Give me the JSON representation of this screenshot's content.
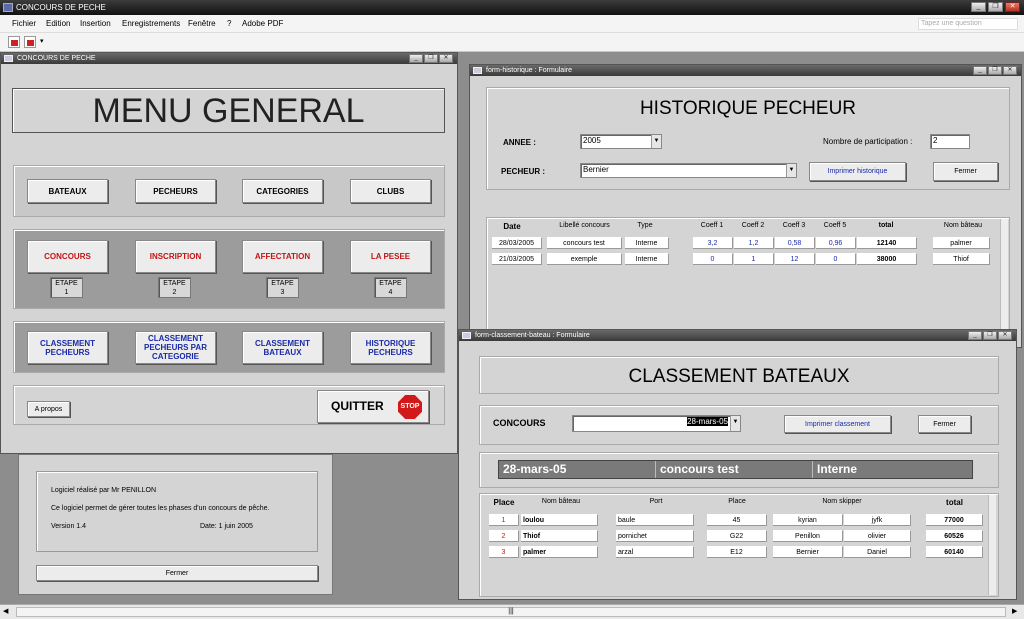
{
  "app": {
    "title": "CONCOURS DE PECHE"
  },
  "menu": {
    "items": [
      "Fichier",
      "Edition",
      "Insertion",
      "Enregistrements",
      "Fenêtre",
      "?",
      "Adobe PDF"
    ],
    "ask_placeholder": "Tapez une question"
  },
  "menu_general": {
    "window_title": "CONCOURS DE PECHE",
    "heading": "MENU GENERAL",
    "row1": [
      "BATEAUX",
      "PECHEURS",
      "CATEGORIES",
      "CLUBS"
    ],
    "row2": [
      "CONCOURS",
      "INSCRIPTION",
      "AFFECTATION",
      "LA PESEE"
    ],
    "etape_label": "ETAPE",
    "etapes": [
      "1",
      "2",
      "3",
      "4"
    ],
    "row3_1": [
      "CLASSEMENT",
      "PECHEURS"
    ],
    "row3_2": [
      "CLASSEMENT",
      "PECHEURS PAR",
      "CATEGORIE"
    ],
    "row3_3": [
      "CLASSEMENT",
      "BATEAUX"
    ],
    "row3_4": [
      "HISTORIQUE",
      "PECHEURS"
    ],
    "apropos": "A propos",
    "quitter": "QUITTER",
    "stop": "STOP"
  },
  "about": {
    "line1": "Logiciel réalisé par Mr PENILLON",
    "line2": "Ce logiciel  permet de gérer toutes les phases d'un concours de pêche.",
    "version": "Version 1.4",
    "date": "Date: 1 juin 2005",
    "close": "Fermer"
  },
  "historique": {
    "window_title": "form-historique : Formulaire",
    "heading": "HISTORIQUE PECHEUR",
    "annee_label": "ANNEE :",
    "annee": "2005",
    "participation_label": "Nombre de participation :",
    "participation": "2",
    "pecheur_label": "PECHEUR :",
    "pecheur": "Bernier",
    "print": "Imprimer historique",
    "close": "Fermer",
    "columns": [
      "Date",
      "Libellé concours",
      "Type",
      "Coeff 1",
      "Coeff 2",
      "Coeff 3",
      "Coeff 5",
      "total",
      "Nom bâteau"
    ],
    "rows": [
      [
        "28/03/2005",
        "concours test",
        "Interne",
        "3,2",
        "1,2",
        "0,58",
        "0,96",
        "12140",
        "palmer"
      ],
      [
        "21/03/2005",
        "exemple",
        "Interne",
        "0",
        "1",
        "12",
        "0",
        "38000",
        "Thiof"
      ]
    ]
  },
  "classement": {
    "window_title": "form-classement-bateau : Formulaire",
    "heading": "CLASSEMENT BATEAUX",
    "concours_label": "CONCOURS",
    "concours": "28-mars-05",
    "print": "Imprimer classement",
    "close": "Fermer",
    "banner": [
      "28-mars-05",
      "concours test",
      "Interne"
    ],
    "columns": [
      "Place",
      "Nom bâteau",
      "Port",
      "Place",
      "Nom skipper",
      "total"
    ],
    "rows": [
      [
        "1",
        "loulou",
        "baule",
        "45",
        "kyrian",
        "jyfk",
        "77000"
      ],
      [
        "2",
        "Thiof",
        "pornichet",
        "G22",
        "Penillon",
        "olivier",
        "60526"
      ],
      [
        "3",
        "palmer",
        "arzal",
        "E12",
        "Bernier",
        "Daniel",
        "60140"
      ]
    ]
  },
  "colors": {
    "red": "#c21515",
    "blue": "#1a2aa8"
  }
}
